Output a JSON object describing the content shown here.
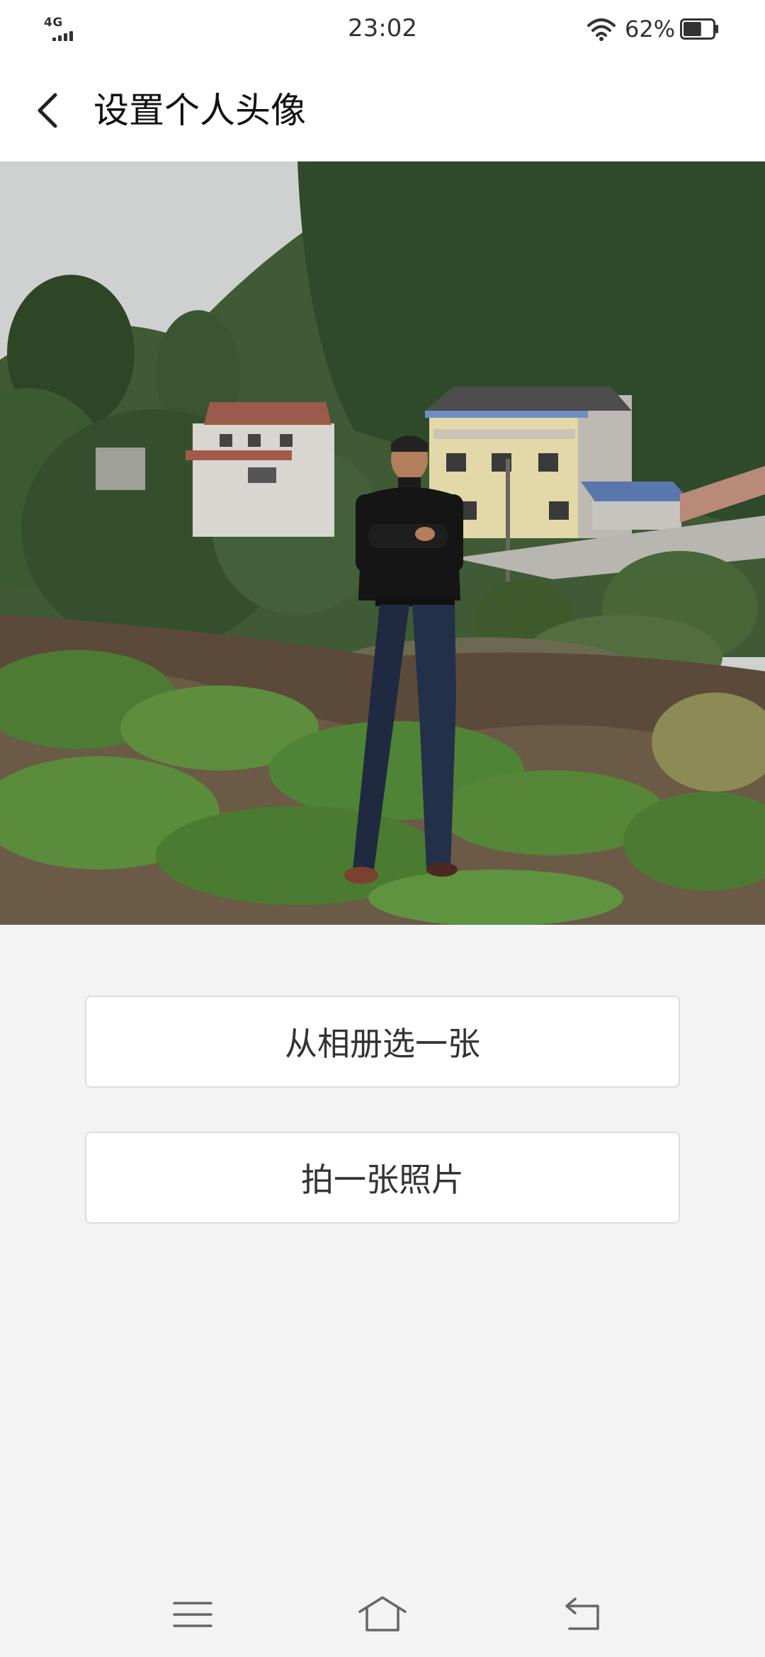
{
  "status_bar": {
    "network": "4G",
    "time": "23:02",
    "battery_percent": "62%",
    "battery_level": 0.62,
    "icons": [
      "signal-icon",
      "wifi-icon",
      "battery-icon"
    ]
  },
  "header": {
    "back_icon": "chevron-left-icon",
    "title": "设置个人头像"
  },
  "preview": {
    "description_icon": "avatar-photo"
  },
  "actions": {
    "choose_from_album": "从相册选一张",
    "take_photo": "拍一张照片"
  },
  "nav_bar": {
    "icons": [
      "menu-icon",
      "home-icon",
      "return-icon"
    ]
  },
  "colors": {
    "background": "#f3f3f3",
    "surface": "#ffffff",
    "text": "#333333",
    "border": "#dcdcdc"
  }
}
